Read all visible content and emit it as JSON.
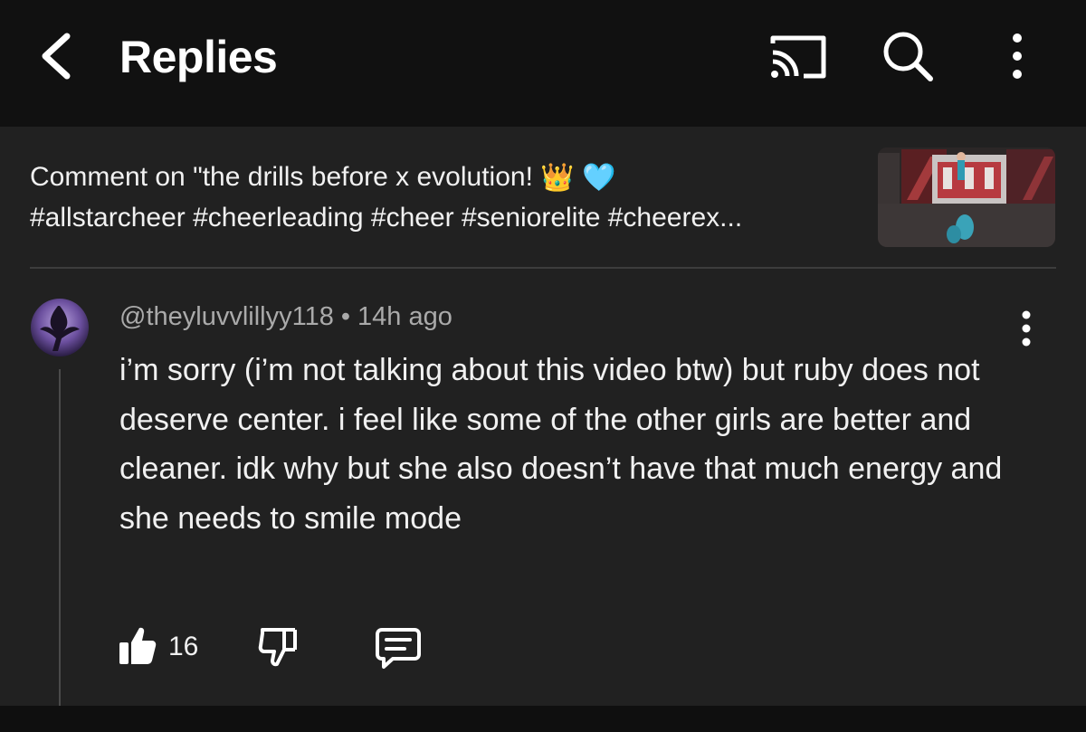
{
  "header": {
    "title": "Replies",
    "icons": {
      "back": "chevron-left-icon",
      "cast": "cast-icon",
      "search": "search-icon",
      "more": "more-vert-icon"
    }
  },
  "video_comment": {
    "prefix": "Comment on \"the drills before x evolution! ",
    "emojis": [
      "👑",
      "🩵"
    ],
    "hashtags": "#allstarcheer #cheerleading #cheer #seniorelite #cheerex..."
  },
  "comment": {
    "author": "@theyluvvlillyy118",
    "separator": "•",
    "time": "14h ago",
    "text": "i’m sorry (i’m not talking about this video btw) but ruby does not deserve center. i feel like some of the other girls are better and cleaner. idk why but she also doesn’t have that much energy and she needs to smile mode",
    "like_count": "16",
    "icons": {
      "like": "thumbs-up-icon",
      "dislike": "thumbs-down-icon",
      "reply": "reply-comment-icon",
      "more": "more-vert-icon"
    }
  },
  "colors": {
    "app_bar": "#111111",
    "panel": "#212121",
    "text": "#f1f1f1",
    "secondary_text": "#aaaaaa"
  }
}
